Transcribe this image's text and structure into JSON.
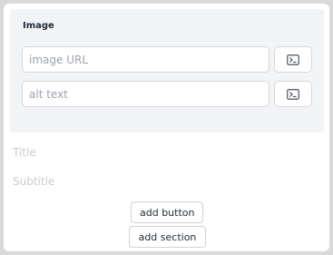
{
  "image_panel": {
    "title": "Image",
    "url_placeholder": "image URL",
    "alt_placeholder": "alt text",
    "icon": "terminal-icon"
  },
  "title_field": {
    "placeholder": "Title"
  },
  "subtitle_field": {
    "placeholder": "Subtitle"
  },
  "actions": {
    "add_button_label": "add button",
    "add_section_label": "add section"
  },
  "colors": {
    "panel_bg": "#f3f4f6",
    "border": "#d4d7dd",
    "text": "#1f2937",
    "placeholder": "#9ca3af"
  }
}
